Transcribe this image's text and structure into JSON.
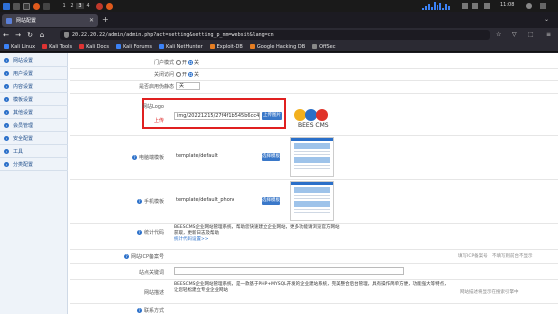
{
  "os": {
    "workspaces": [
      "1",
      "2",
      "3",
      "4"
    ],
    "active_workspace": "3",
    "clock": "11:08",
    "graph_levels": [
      0.3,
      0.5,
      0.8,
      0.4,
      1.0,
      0.6,
      0.9,
      0.3,
      0.7,
      0.5
    ]
  },
  "browser": {
    "tab_title": "网站配置",
    "url": "20.22.20.22/admin/admin.php?act=setting&setting_p_nm=websit&lang=cn",
    "bookmarks": [
      "Kali Linux",
      "Kali Tools",
      "Kali Docs",
      "Kali Forums",
      "Kali NetHunter",
      "Exploit-DB",
      "Google Hacking DB",
      "OffSec"
    ]
  },
  "sidebar": {
    "items": [
      "网站设置",
      "用户设置",
      "内容设置",
      "模板设置",
      "其他设置",
      "会员管理",
      "安全配置",
      "工具",
      "分类配置"
    ]
  },
  "form": {
    "row1_label": "门户模式",
    "row1_opts": [
      "开",
      "关"
    ],
    "row2_label": "关闭访问",
    "row2_opts": [
      "开",
      "关"
    ],
    "row3_label": "是否启用伪静态",
    "row3_value": "关",
    "logo_label": "网站Logo",
    "logo_sub": "上传",
    "logo_value": "img/20221215/27f4f1b545b6cc45c9.jpg",
    "upload_btn": "上传图片",
    "logo_text": "BEES CMS",
    "tpl_pc_label": "电脑端模板",
    "tpl_pc_value": "template/default",
    "tpl_btn": "选择模板",
    "tpl_mobile_label": "手机模板",
    "tpl_mobile_value": "template/default_phone",
    "code_label": "统计代码",
    "code_text": "BEESCMS企业网站管理系统，帮助您快速建立企业网站，更多功能请浏览官方网站获取，更新日志及帮助",
    "code_link": "统计代码设置>>",
    "row8_label": "网站ICP备案号",
    "row8_hint": "填写ICP备案号",
    "row8_hint2": "不填写则前台不显示",
    "row9_label": "站点关键词",
    "row10_label": "网站描述",
    "row10_text": "BEESCMS企业网站管理系统，是一款基于PHP+MYSQL开发的企业建站系统，完美整合后台管理，具有操作简单方便，功能强大等特点，让您轻松建立专业企业网站",
    "row10_hint": "网站描述将显示在搜索引擎中",
    "row11_label": "联系方式"
  }
}
